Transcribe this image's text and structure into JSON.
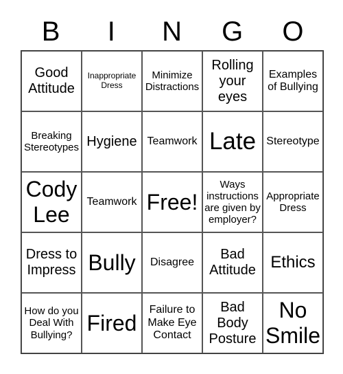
{
  "header": {
    "letters": [
      "B",
      "I",
      "N",
      "G",
      "O"
    ]
  },
  "board": {
    "rows": [
      [
        {
          "text": "Good Attitude",
          "size": "s-lg"
        },
        {
          "text": "Inappropriate Dress",
          "size": "s-xs"
        },
        {
          "text": "Minimize Distractions",
          "size": "s-sm"
        },
        {
          "text": "Rolling your eyes",
          "size": "s-lg"
        },
        {
          "text": "Examples of Bullying",
          "size": "s-md"
        }
      ],
      [
        {
          "text": "Breaking Stereotypes",
          "size": "s-sm"
        },
        {
          "text": "Hygiene",
          "size": "s-lg"
        },
        {
          "text": "Teamwork",
          "size": "s-md"
        },
        {
          "text": "Late",
          "size": "s-xxxl"
        },
        {
          "text": "Stereotype",
          "size": "s-md"
        }
      ],
      [
        {
          "text": "Cody Lee",
          "size": "s-xxl"
        },
        {
          "text": "Teamwork",
          "size": "s-md"
        },
        {
          "text": "Free!",
          "size": "s-xxl"
        },
        {
          "text": "Ways instructions are given by employer?",
          "size": "s-sm"
        },
        {
          "text": "Appropriate Dress",
          "size": "s-sm"
        }
      ],
      [
        {
          "text": "Dress to Impress",
          "size": "s-lg"
        },
        {
          "text": "Bully",
          "size": "s-xxl"
        },
        {
          "text": "Disagree",
          "size": "s-md"
        },
        {
          "text": "Bad Attitude",
          "size": "s-lg"
        },
        {
          "text": "Ethics",
          "size": "s-xl"
        }
      ],
      [
        {
          "text": "How do you Deal With Bullying?",
          "size": "s-sm"
        },
        {
          "text": "Fired",
          "size": "s-xxl"
        },
        {
          "text": "Failure to Make Eye Contact",
          "size": "s-md"
        },
        {
          "text": "Bad Body Posture",
          "size": "s-lg"
        },
        {
          "text": "No Smile",
          "size": "s-xxl"
        }
      ]
    ]
  }
}
